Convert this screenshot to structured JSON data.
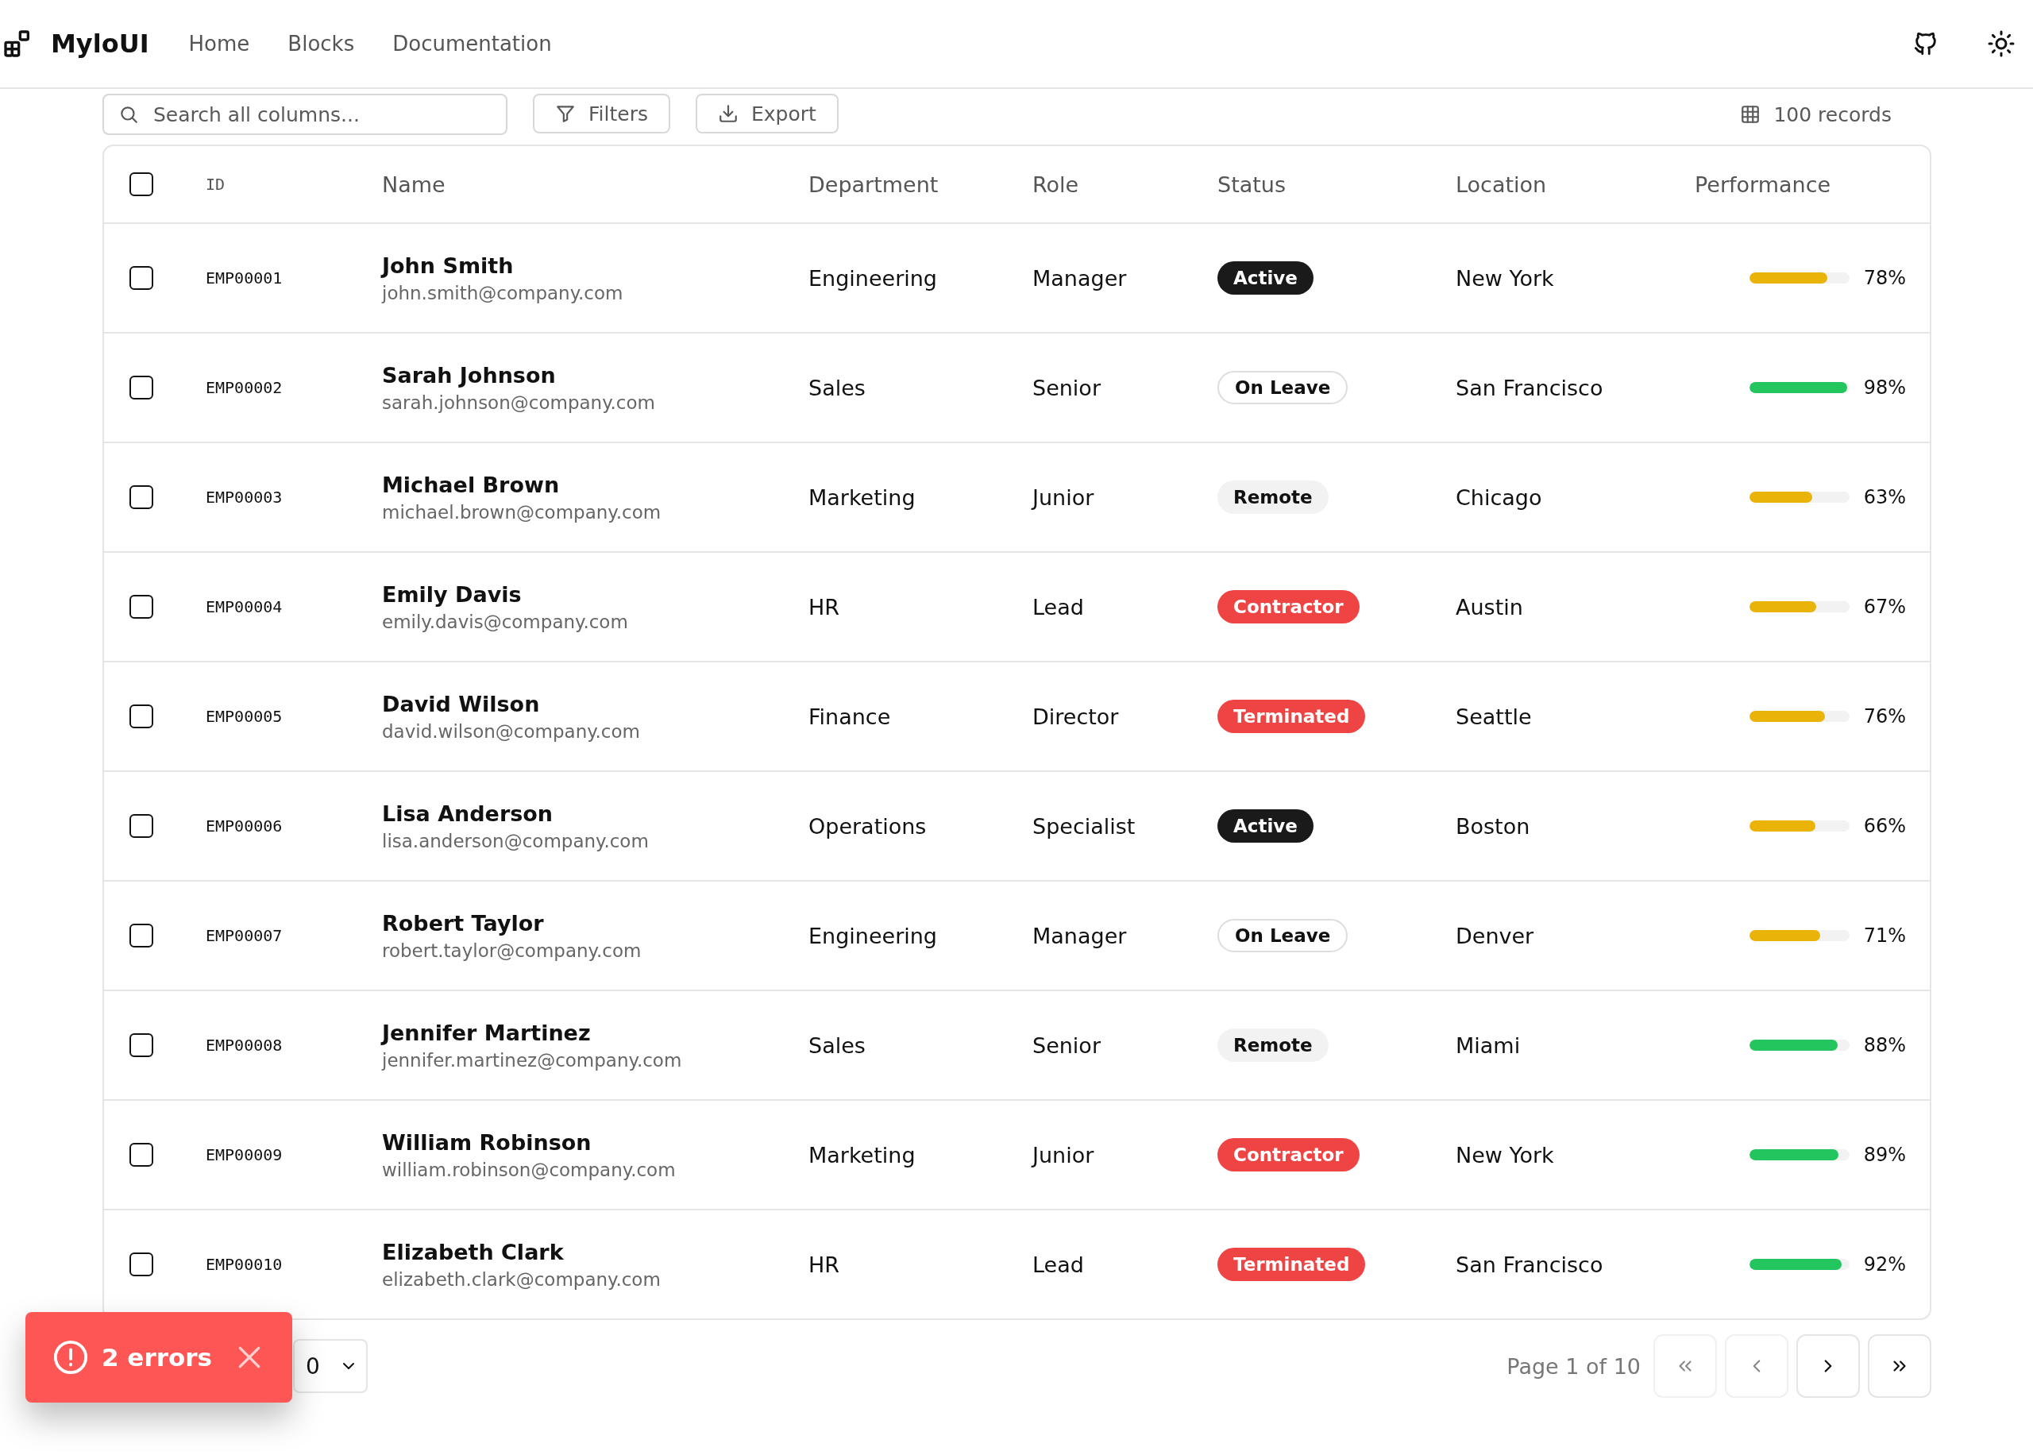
{
  "header": {
    "brand": "MyloUI",
    "nav": [
      {
        "label": "Home"
      },
      {
        "label": "Blocks"
      },
      {
        "label": "Documentation"
      }
    ]
  },
  "toolbar": {
    "search": {
      "placeholder": "Search all columns..."
    },
    "filters": "Filters",
    "export": "Export",
    "records": "100 records"
  },
  "table": {
    "header_checkbox": {
      "checked": false
    },
    "columns": [
      "ID",
      "Name",
      "Department",
      "Role",
      "Status",
      "Location",
      "Performance"
    ],
    "rows": [
      {
        "checked": false,
        "id": "EMP00001",
        "name": "John Smith",
        "email": "john.smith@company.com",
        "department": "Engineering",
        "role": "Manager",
        "status": {
          "label": "Active",
          "kind": "dark"
        },
        "location": "New York",
        "performance": {
          "level": 0.78,
          "color": "#eab308",
          "reading": "78%"
        }
      },
      {
        "checked": false,
        "id": "EMP00002",
        "name": "Sarah Johnson",
        "email": "sarah.johnson@company.com",
        "department": "Sales",
        "role": "Senior",
        "status": {
          "label": "On Leave",
          "kind": "outline"
        },
        "location": "San Francisco",
        "performance": {
          "level": 0.98,
          "color": "#22c55e",
          "reading": "98%"
        }
      },
      {
        "checked": false,
        "id": "EMP00003",
        "name": "Michael Brown",
        "email": "michael.brown@company.com",
        "department": "Marketing",
        "role": "Junior",
        "status": {
          "label": "Remote",
          "kind": "muted"
        },
        "location": "Chicago",
        "performance": {
          "level": 0.63,
          "color": "#eab308",
          "reading": "63%"
        }
      },
      {
        "checked": false,
        "id": "EMP00004",
        "name": "Emily Davis",
        "email": "emily.davis@company.com",
        "department": "HR",
        "role": "Lead",
        "status": {
          "label": "Contractor",
          "kind": "red"
        },
        "location": "Austin",
        "performance": {
          "level": 0.67,
          "color": "#eab308",
          "reading": "67%"
        }
      },
      {
        "checked": false,
        "id": "EMP00005",
        "name": "David Wilson",
        "email": "david.wilson@company.com",
        "department": "Finance",
        "role": "Director",
        "status": {
          "label": "Terminated",
          "kind": "red"
        },
        "location": "Seattle",
        "performance": {
          "level": 0.76,
          "color": "#eab308",
          "reading": "76%"
        }
      },
      {
        "checked": false,
        "id": "EMP00006",
        "name": "Lisa Anderson",
        "email": "lisa.anderson@company.com",
        "department": "Operations",
        "role": "Specialist",
        "status": {
          "label": "Active",
          "kind": "dark"
        },
        "location": "Boston",
        "performance": {
          "level": 0.66,
          "color": "#eab308",
          "reading": "66%"
        }
      },
      {
        "checked": false,
        "id": "EMP00007",
        "name": "Robert Taylor",
        "email": "robert.taylor@company.com",
        "department": "Engineering",
        "role": "Manager",
        "status": {
          "label": "On Leave",
          "kind": "outline"
        },
        "location": "Denver",
        "performance": {
          "level": 0.71,
          "color": "#eab308",
          "reading": "71%"
        }
      },
      {
        "checked": false,
        "id": "EMP00008",
        "name": "Jennifer Martinez",
        "email": "jennifer.martinez@company.com",
        "department": "Sales",
        "role": "Senior",
        "status": {
          "label": "Remote",
          "kind": "muted"
        },
        "location": "Miami",
        "performance": {
          "level": 0.88,
          "color": "#22c55e",
          "reading": "88%"
        }
      },
      {
        "checked": false,
        "id": "EMP00009",
        "name": "William Robinson",
        "email": "william.robinson@company.com",
        "department": "Marketing",
        "role": "Junior",
        "status": {
          "label": "Contractor",
          "kind": "red"
        },
        "location": "New York",
        "performance": {
          "level": 0.89,
          "color": "#22c55e",
          "reading": "89%"
        }
      },
      {
        "checked": false,
        "id": "EMP00010",
        "name": "Elizabeth Clark",
        "email": "elizabeth.clark@company.com",
        "department": "HR",
        "role": "Lead",
        "status": {
          "label": "Terminated",
          "kind": "red"
        },
        "location": "San Francisco",
        "performance": {
          "level": 0.92,
          "color": "#22c55e",
          "reading": "92%"
        }
      }
    ]
  },
  "pagination": {
    "page_size": "0",
    "page_info": "Page 1 of 10",
    "buttons": [
      {
        "kind": "first",
        "disabled": true
      },
      {
        "kind": "prev",
        "disabled": true
      },
      {
        "kind": "next",
        "disabled": false
      },
      {
        "kind": "last",
        "disabled": false
      }
    ]
  },
  "toast": {
    "message": "2 errors"
  }
}
